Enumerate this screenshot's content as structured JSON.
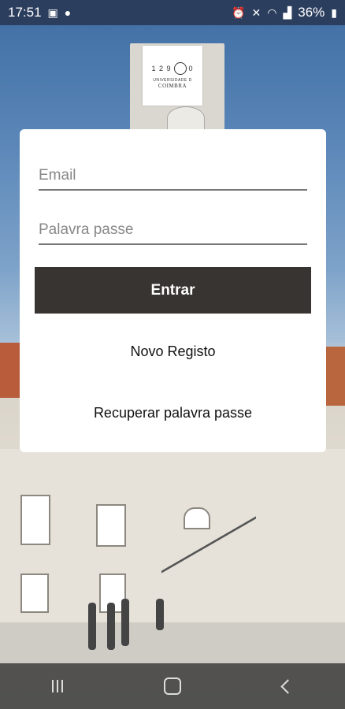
{
  "status_bar": {
    "time": "17:51",
    "battery": "36%"
  },
  "logo": {
    "mark_left": "1 2 9",
    "mark_right": "0",
    "line1": "UNIVERSIDADE D",
    "line2": "COIMBRA"
  },
  "login": {
    "email_placeholder": "Email",
    "password_placeholder": "Palavra passe",
    "submit_label": "Entrar",
    "register_label": "Novo Registo",
    "recover_label": "Recuperar palavra passe"
  },
  "icons": {
    "notification_1": "image-icon",
    "notification_2": "location-icon",
    "alarm": "alarm-icon",
    "mute": "mute-icon",
    "wifi": "wifi-icon",
    "signal": "signal-icon",
    "battery": "battery-icon",
    "nav_recent": "recent-apps-icon",
    "nav_home": "home-icon",
    "nav_back": "back-icon"
  },
  "colors": {
    "status_bar": "#2c3e5e",
    "button": "#383432",
    "card": "#ffffff"
  }
}
